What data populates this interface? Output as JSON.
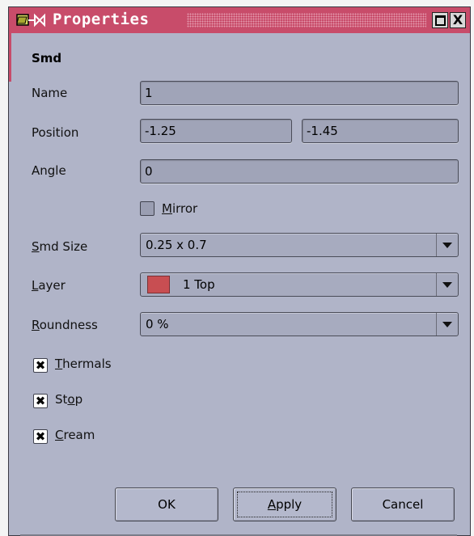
{
  "window": {
    "title": "Properties",
    "maximize_label": "□",
    "close_label": "X"
  },
  "section": {
    "title": "Smd"
  },
  "fields": {
    "name": {
      "label": "Name",
      "value": "1"
    },
    "position": {
      "label": "Position",
      "x": "-1.25",
      "y": "-1.45"
    },
    "angle": {
      "label": "Angle",
      "value": "0"
    }
  },
  "mirror": {
    "mnemonic": "M",
    "rest": "irror",
    "checked": false
  },
  "smd_size": {
    "mnemonic": "S",
    "rest": "md Size",
    "value": "0.25 x 0.7"
  },
  "layer": {
    "mnemonic": "L",
    "rest": "ayer",
    "value": "1 Top",
    "color": "#c84e52"
  },
  "roundness": {
    "mnemonic": "R",
    "rest": "oundness",
    "value": "0 %"
  },
  "thermals": {
    "mnemonic": "T",
    "rest": "hermals",
    "checked": true
  },
  "stop": {
    "pre": "St",
    "mnemonic": "o",
    "rest": "p",
    "checked": true
  },
  "cream": {
    "mnemonic": "C",
    "rest": "ream",
    "checked": true
  },
  "buttons": {
    "ok": "OK",
    "apply_mnemonic": "A",
    "apply_rest": "pply",
    "cancel": "Cancel"
  },
  "colors": {
    "titlebar": "#c84c6a",
    "dialog_bg": "#b0b4c8",
    "field_bg": "#a0a4b8"
  }
}
